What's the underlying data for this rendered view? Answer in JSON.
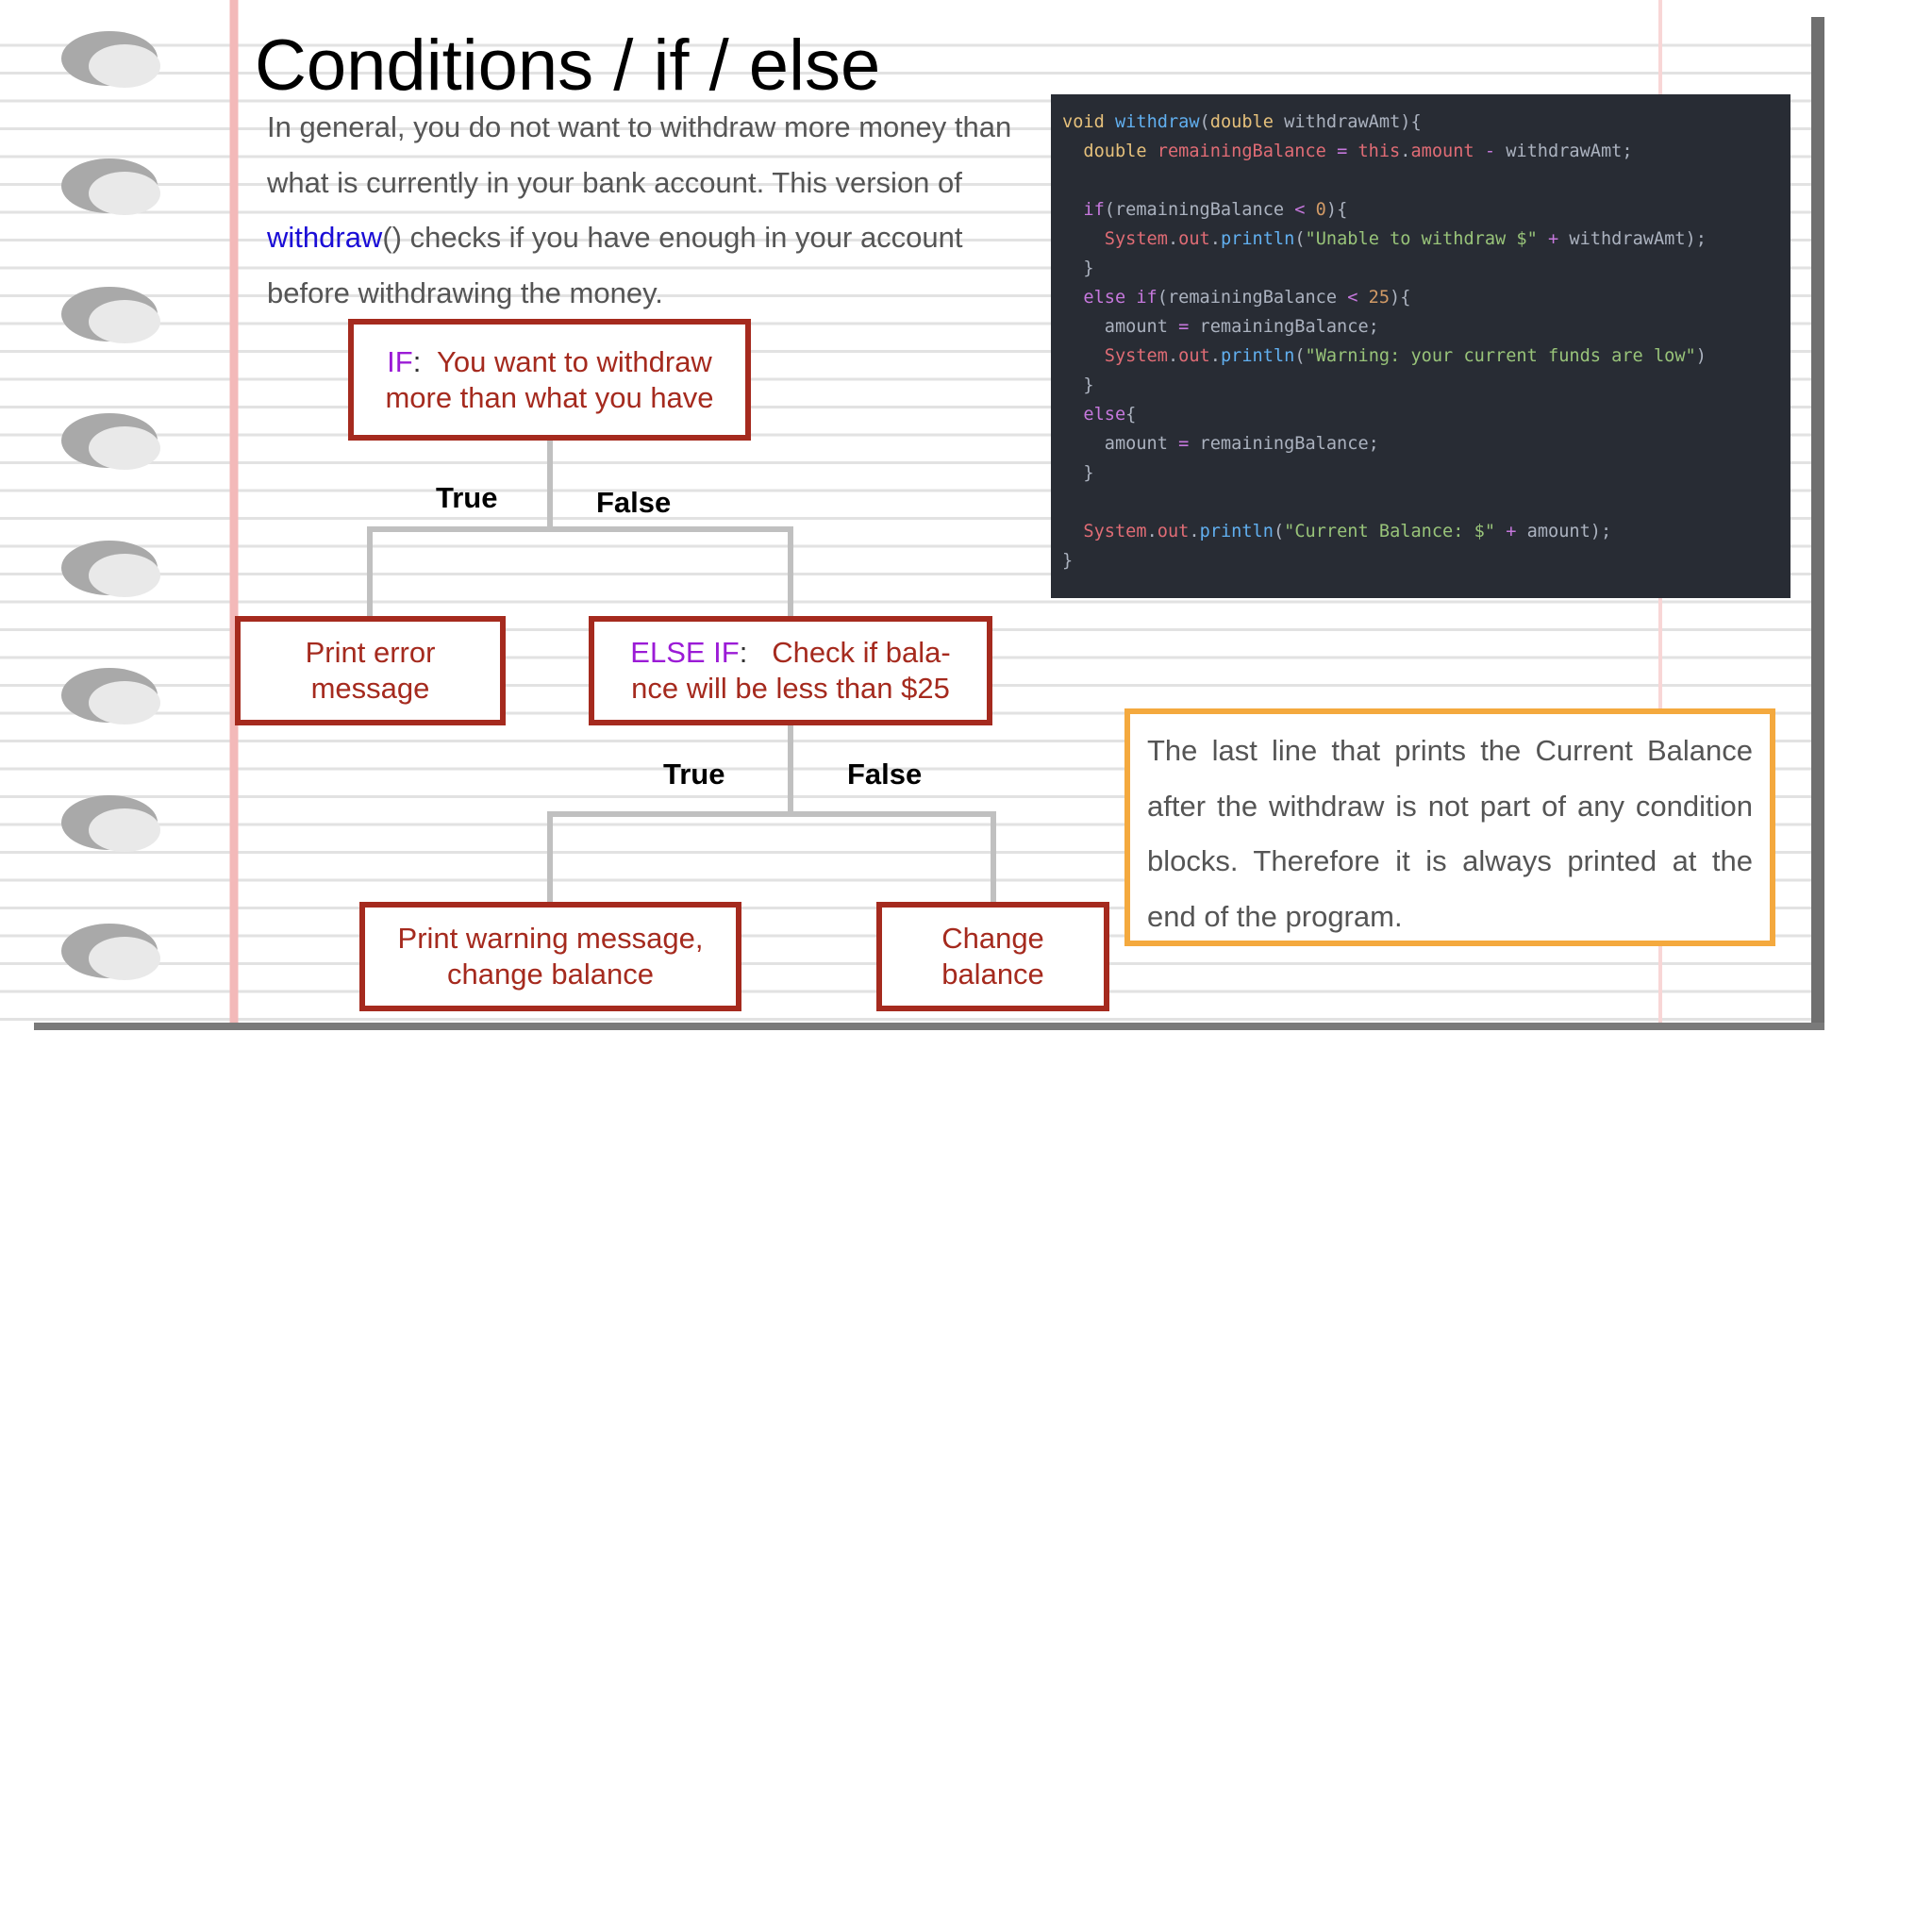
{
  "slide": {
    "title": "Conditions / if / else",
    "intro": {
      "before": "In general, you do not want to withdraw more money than what is currently in your bank account. This version of ",
      "keyword": "withdraw",
      "after": "() checks if you have enough in your account before withdrawing the money."
    }
  },
  "flowchart": {
    "if_box": {
      "keyword": "IF",
      "separator": ":",
      "text": "You want to withdraw more than what you have"
    },
    "branch_true_1": "True",
    "branch_false_1": "False",
    "error_box": "Print error message",
    "elseif_box": {
      "keyword": "ELSE IF",
      "separator": ":",
      "text": "Check if bala-nce will be less than $25"
    },
    "branch_true_2": "True",
    "branch_false_2": "False",
    "warning_box": "Print warning message, change balance",
    "change_box": "Change balance",
    "connector_color": "#c0c0c0",
    "box_border_color": "#a52a1e"
  },
  "code": {
    "background": "#282c34",
    "lines": [
      [
        [
          "kw",
          "void "
        ],
        [
          "fn",
          "withdraw"
        ],
        [
          "pl",
          "("
        ],
        [
          "kw",
          "double "
        ],
        [
          "pl",
          "withdrawAmt){"
        ]
      ],
      [
        [
          "pl",
          "  "
        ],
        [
          "kw",
          "double "
        ],
        [
          "var",
          "remainingBalance "
        ],
        [
          "op",
          "= "
        ],
        [
          "var",
          "this"
        ],
        [
          "pl",
          "."
        ],
        [
          "var",
          "amount "
        ],
        [
          "op",
          "- "
        ],
        [
          "pl",
          "withdrawAmt;"
        ]
      ],
      [],
      [
        [
          "pl",
          "  "
        ],
        [
          "ctl",
          "if"
        ],
        [
          "pl",
          "(remainingBalance "
        ],
        [
          "op",
          "< "
        ],
        [
          "num",
          "0"
        ],
        [
          "pl",
          "){"
        ]
      ],
      [
        [
          "pl",
          "    "
        ],
        [
          "var",
          "System"
        ],
        [
          "pl",
          "."
        ],
        [
          "var",
          "out"
        ],
        [
          "pl",
          "."
        ],
        [
          "fn",
          "println"
        ],
        [
          "pl",
          "("
        ],
        [
          "str",
          "\"Unable to withdraw $\" "
        ],
        [
          "op",
          "+ "
        ],
        [
          "pl",
          "withdrawAmt);"
        ]
      ],
      [
        [
          "pl",
          "  }"
        ]
      ],
      [
        [
          "pl",
          "  "
        ],
        [
          "ctl",
          "else if"
        ],
        [
          "pl",
          "(remainingBalance "
        ],
        [
          "op",
          "< "
        ],
        [
          "num",
          "25"
        ],
        [
          "pl",
          "){"
        ]
      ],
      [
        [
          "pl",
          "    amount "
        ],
        [
          "op",
          "= "
        ],
        [
          "pl",
          "remainingBalance;"
        ]
      ],
      [
        [
          "pl",
          "    "
        ],
        [
          "var",
          "System"
        ],
        [
          "pl",
          "."
        ],
        [
          "var",
          "out"
        ],
        [
          "pl",
          "."
        ],
        [
          "fn",
          "println"
        ],
        [
          "pl",
          "("
        ],
        [
          "str",
          "\"Warning: your current funds are low\""
        ],
        [
          "pl",
          ")"
        ]
      ],
      [
        [
          "pl",
          "  }"
        ]
      ],
      [
        [
          "pl",
          "  "
        ],
        [
          "ctl",
          "else"
        ],
        [
          "pl",
          "{"
        ]
      ],
      [
        [
          "pl",
          "    amount "
        ],
        [
          "op",
          "= "
        ],
        [
          "pl",
          "remainingBalance;"
        ]
      ],
      [
        [
          "pl",
          "  }"
        ]
      ],
      [],
      [
        [
          "pl",
          "  "
        ],
        [
          "var",
          "System"
        ],
        [
          "pl",
          "."
        ],
        [
          "var",
          "out"
        ],
        [
          "pl",
          "."
        ],
        [
          "fn",
          "println"
        ],
        [
          "pl",
          "("
        ],
        [
          "str",
          "\"Current Balance: $\" "
        ],
        [
          "op",
          "+ "
        ],
        [
          "pl",
          "amount);"
        ]
      ],
      [
        [
          "pl",
          "}"
        ]
      ]
    ]
  },
  "note": {
    "text": "The last line that prints the Current Balance after the withdraw is not part of any condition blocks. Therefore it is always printed at the end of the program.",
    "border_color": "#f4a93e"
  },
  "icons": {
    "binder_hole": "binder-hole-icon"
  }
}
